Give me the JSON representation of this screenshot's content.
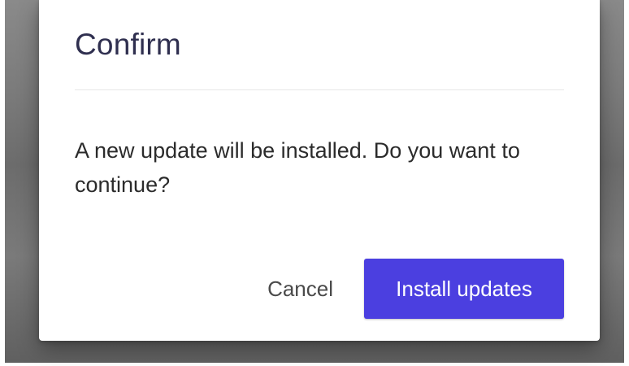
{
  "dialog": {
    "title": "Confirm",
    "message": "A new update will be installed. Do you want to continue?",
    "cancel_label": "Cancel",
    "confirm_label": "Install updates"
  },
  "colors": {
    "primary": "#4b3fe0",
    "overlay": "#7a7a7a",
    "title_text": "#2f2f4f",
    "body_text": "#2b2b2b"
  }
}
